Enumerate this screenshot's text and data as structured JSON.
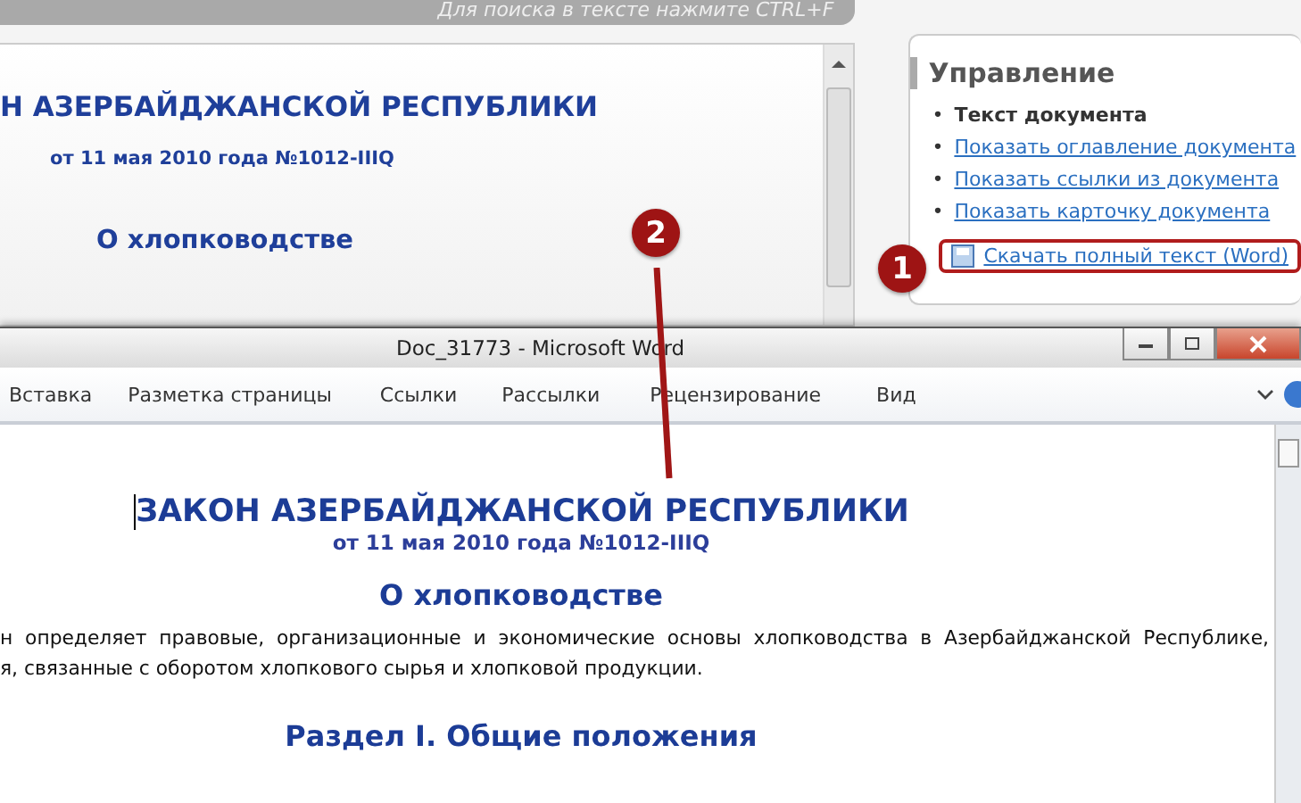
{
  "web_page": {
    "search_hint": "Для поиска в тексте нажмите CTRL+F",
    "document": {
      "title": "Н АЗЕРБАЙДЖАНСКОЙ РЕСПУБЛИКИ",
      "date": "от 11 мая 2010 года №1012-IIIQ",
      "subject": "О хлопководстве"
    },
    "control_panel": {
      "title": "Управление",
      "items": [
        {
          "marker": "•",
          "label": "Текст документа",
          "selected": true
        },
        {
          "marker": "•",
          "label": "Показать оглавление документа",
          "selected": false
        },
        {
          "marker": "•",
          "label": "Показать ссылки из документа",
          "selected": false
        },
        {
          "marker": "•",
          "label": "Показать карточку документа",
          "selected": false
        }
      ],
      "download_link": "Скачать полный текст (Word)"
    }
  },
  "word_window": {
    "title": "Doc_31773  -  Microsoft Word",
    "ribbon_tabs": [
      "Вставка",
      "Разметка страницы",
      "Ссылки",
      "Рассылки",
      "Рецензирование",
      "Вид"
    ],
    "document": {
      "title": "ЗАКОН АЗЕРБАЙДЖАНСКОЙ РЕСПУБЛИКИ",
      "date": "от 11 мая 2010 года №1012-IIIQ",
      "subject": "О хлопководстве",
      "paragraph_lines": [
        "н определяет правовые, организационные и экономические основы хлопководства в Азербайджанской Республике,",
        "я, связанные с оборотом хлопкового сырья и хлопковой продукции."
      ],
      "section": "Раздел I. Общие положения"
    }
  },
  "callouts": [
    "1",
    "2"
  ]
}
